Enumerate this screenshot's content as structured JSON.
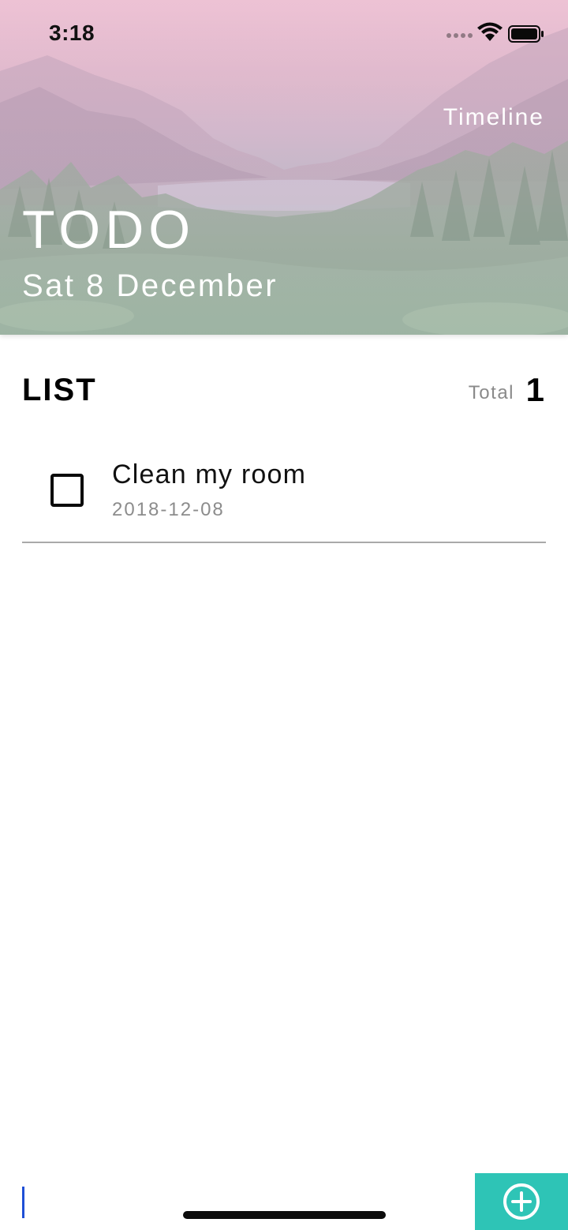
{
  "status_bar": {
    "time": "3:18"
  },
  "header": {
    "nav_link": "Timeline",
    "title": "TODO",
    "date": "Sat 8 December"
  },
  "list": {
    "title": "LIST",
    "total_label": "Total",
    "total_count": "1",
    "items": [
      {
        "title": "Clean my room",
        "date": "2018-12-08",
        "checked": false
      }
    ]
  },
  "colors": {
    "accent": "#2ec4b6",
    "header_tint": "#e9c4d3",
    "muted_text": "#8a8a8a",
    "cursor": "#1f4fd6"
  },
  "icons": {
    "add": "plus-circle-icon",
    "wifi": "wifi-icon",
    "battery": "battery-icon",
    "signal": "signal-icon",
    "checkbox": "checkbox-icon"
  }
}
